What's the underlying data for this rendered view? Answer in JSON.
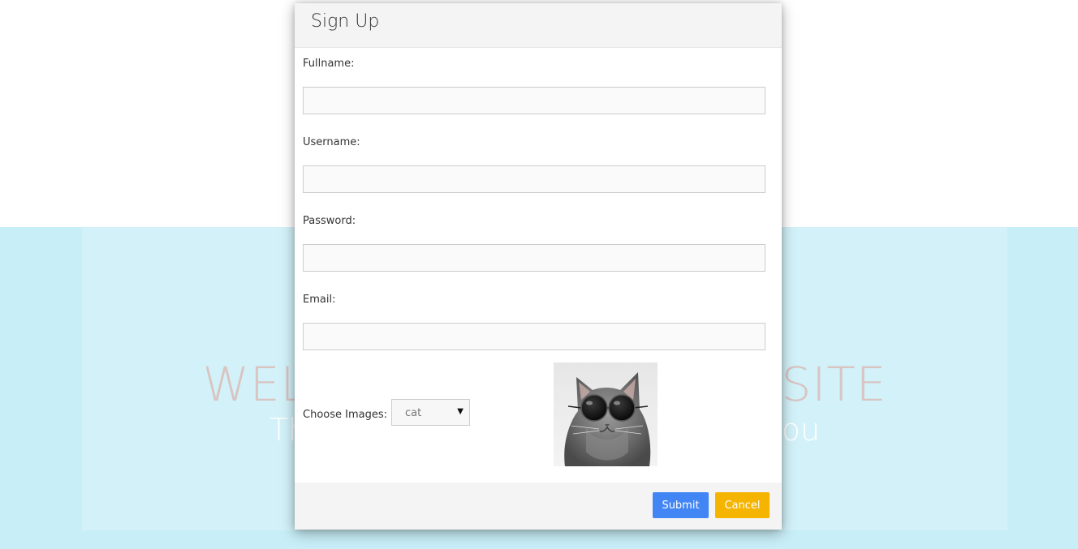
{
  "background": {
    "welcome_title": "WELCOME TO OUR WEBSITE",
    "welcome_subtitle": "Thank you for visiting, we hope you",
    "top_color": "#ffffff",
    "bottom_color": "#c8eef7"
  },
  "modal": {
    "title": "Sign Up",
    "fields": {
      "fullname": {
        "label": "Fullname:",
        "value": ""
      },
      "username": {
        "label": "Username:",
        "value": ""
      },
      "password": {
        "label": "Password:",
        "value": ""
      },
      "email": {
        "label": "Email:",
        "value": ""
      }
    },
    "choose_images": {
      "label": "Choose Images:",
      "selected": "cat",
      "preview_icon": "cat-with-sunglasses-image"
    },
    "buttons": {
      "submit": "Submit",
      "cancel": "Cancel"
    },
    "colors": {
      "submit": "#4285f4",
      "cancel": "#f4b400",
      "header_footer": "#f4f4f4"
    }
  }
}
